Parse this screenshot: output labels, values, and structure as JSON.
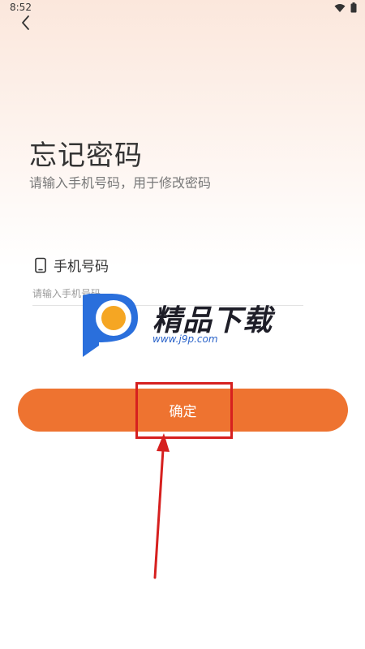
{
  "status_bar": {
    "time": "8:52"
  },
  "header": {
    "title": "忘记密码",
    "subtitle": "请输入手机号码，用于修改密码"
  },
  "phone_field": {
    "label": "手机号码",
    "placeholder": "请输入手机号码",
    "value": ""
  },
  "actions": {
    "confirm_label": "确定"
  },
  "watermark": {
    "brand": "精品下载",
    "url": "www.j9p.com"
  },
  "colors": {
    "accent": "#ee7330",
    "highlight": "#d6201f",
    "watermark_blue": "#2a63c9",
    "watermark_orange": "#f5a623"
  }
}
